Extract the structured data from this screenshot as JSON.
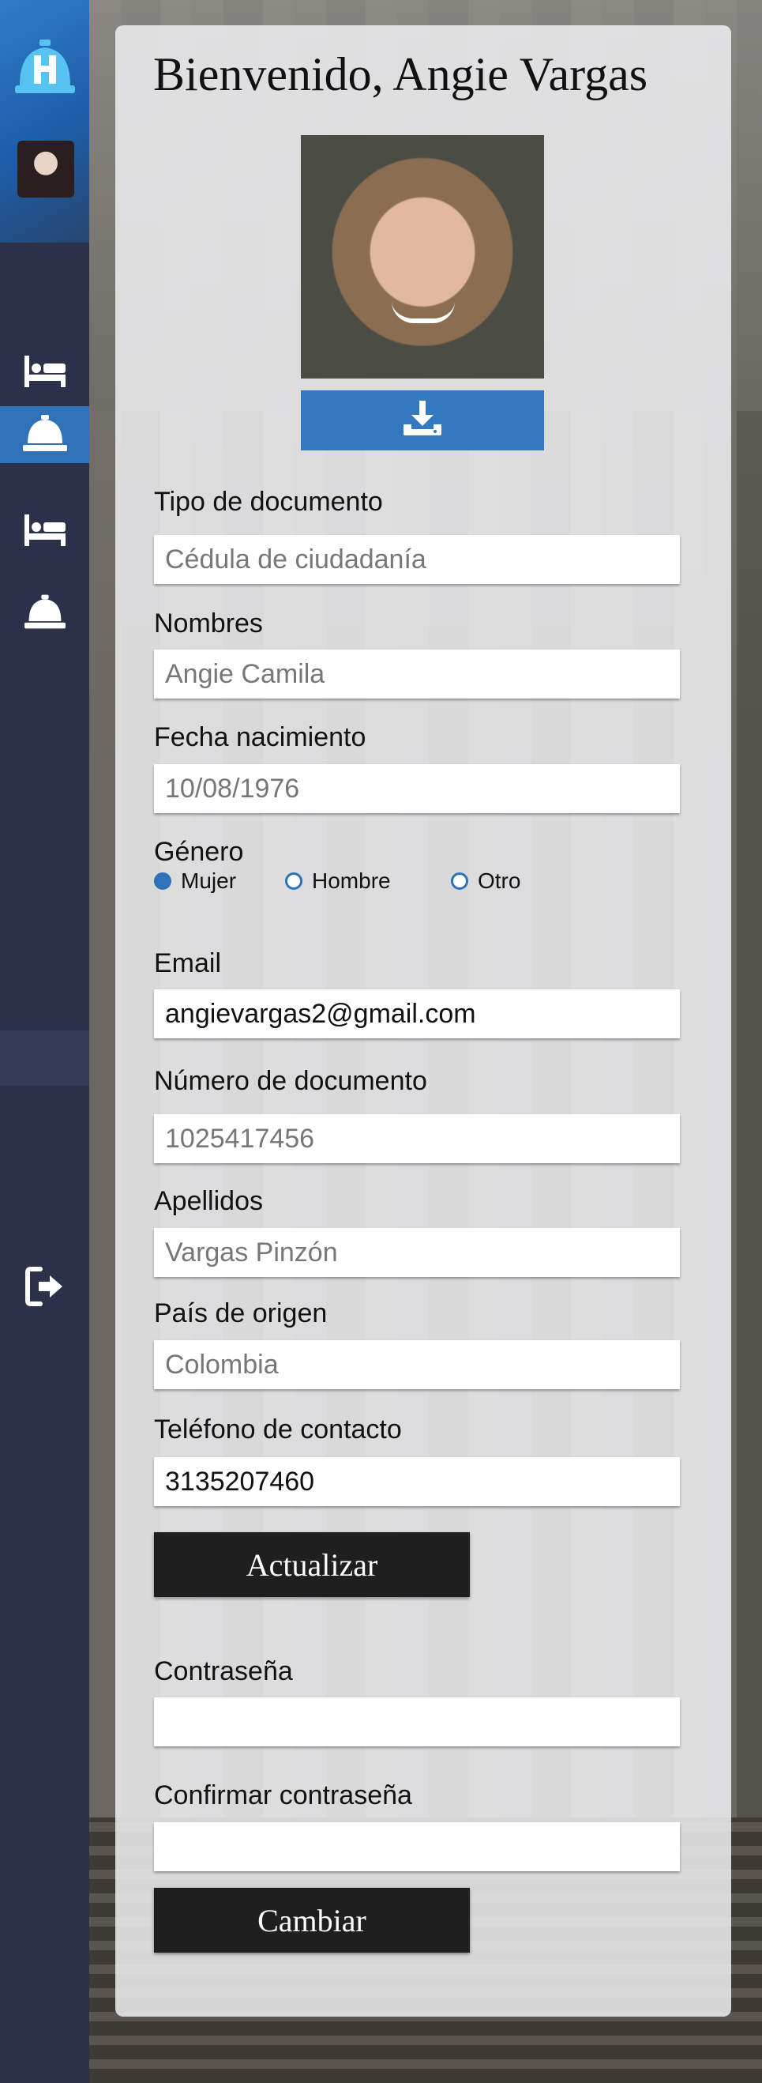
{
  "header": {
    "title": "Bienvenido, Angie Vargas"
  },
  "sidebar": {
    "items": [
      {
        "icon": "bed-icon"
      },
      {
        "icon": "service-bell-icon",
        "active": true
      },
      {
        "icon": "bed-icon"
      },
      {
        "icon": "service-bell-icon"
      }
    ],
    "logout_icon": "logout-icon"
  },
  "profile": {
    "photo_action_icon": "download-icon"
  },
  "form": {
    "tipo_documento": {
      "label": "Tipo de documento",
      "value": "Cédula de ciudadanía"
    },
    "nombres": {
      "label": "Nombres",
      "value": "Angie Camila"
    },
    "fecha_nacimiento": {
      "label": "Fecha nacimiento",
      "value": "10/08/1976"
    },
    "genero": {
      "label": "Género",
      "options": [
        "Mujer",
        "Hombre",
        "Otro"
      ],
      "selected": "Mujer"
    },
    "email": {
      "label": "Email",
      "value": "angievargas2@gmail.com"
    },
    "numero_documento": {
      "label": "Número de documento",
      "value": "1025417456"
    },
    "apellidos": {
      "label": "Apellidos",
      "value": "Vargas Pinzón"
    },
    "pais_origen": {
      "label": "País de origen",
      "value": "Colombia"
    },
    "telefono": {
      "label": "Teléfono de contacto",
      "value": "3135207460"
    },
    "update_label": "Actualizar"
  },
  "password": {
    "password_label": "Contraseña",
    "password_value": "",
    "confirm_label": "Confirmar contraseña",
    "confirm_value": "",
    "change_label": "Cambiar"
  },
  "colors": {
    "accent": "#2f72b7",
    "sidebar": "#2b3149",
    "button_dark": "#1f1f1f"
  }
}
